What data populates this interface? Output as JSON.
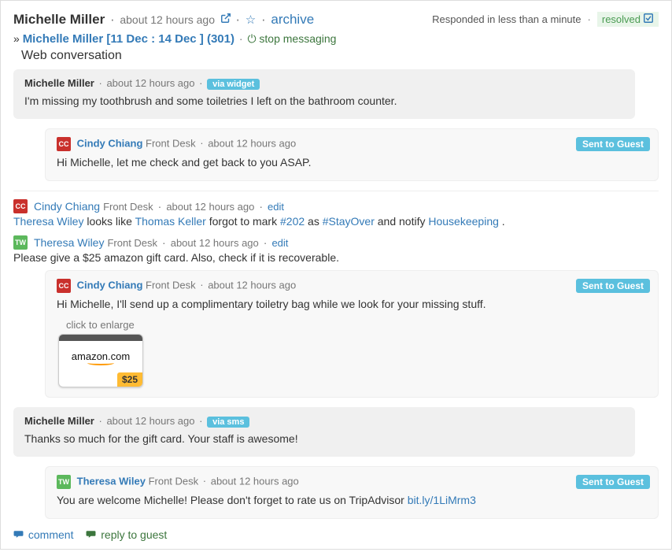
{
  "header": {
    "guest_name": "Michelle Miller",
    "timestamp": "about 12 hours ago",
    "archive_label": "archive",
    "responded_text": "Responded in less than a minute",
    "resolved_label": "resolved"
  },
  "subheader": {
    "booking_link": "Michelle Miller [11 Dec : 14 Dec ] (301)",
    "stop_label": "stop messaging"
  },
  "web_conversation_label": "Web conversation",
  "messages": [
    {
      "name": "Michelle Miller",
      "ts": "about 12 hours ago",
      "via": "via widget",
      "body": "I'm missing my toothbrush and some toiletries I left on the bathroom counter."
    },
    {
      "name": "Cindy Chiang",
      "role": "Front Desk",
      "ts": "about 12 hours ago",
      "sent_label": "Sent to Guest",
      "body": "Hi Michelle, let me check and get back to you ASAP."
    }
  ],
  "internal_notes": [
    {
      "avatar": "CC",
      "name": "Cindy Chiang",
      "role": "Front Desk",
      "ts": "about 12 hours ago",
      "edit": "edit",
      "body_pre": "",
      "mention1": "Theresa Wiley",
      "body_mid1": "  looks like ",
      "mention2": "Thomas Keller",
      "body_mid2": "  forgot to mark ",
      "room": "#202",
      "body_mid3": "  as ",
      "hashtag": "#StayOver",
      "body_mid4": "  and notify ",
      "mention3": "Housekeeping",
      "body_end": " ."
    },
    {
      "avatar": "TW",
      "name": "Theresa Wiley",
      "role": "Front Desk",
      "ts": "about 12 hours ago",
      "edit": "edit",
      "body": "Please give a $25 amazon gift card. Also, check if it is recoverable."
    }
  ],
  "messages2": [
    {
      "name": "Cindy Chiang",
      "role": "Front Desk",
      "ts": "about 12 hours ago",
      "sent_label": "Sent to Guest",
      "body": "Hi Michelle, I'll send up a complimentary toiletry bag while we look for your missing stuff.",
      "enlarge": "click to enlarge",
      "giftcard_logo": "amazon.com",
      "giftcard_price": "$25"
    },
    {
      "name": "Michelle Miller",
      "ts": "about 12 hours ago",
      "via": "via sms",
      "body": "Thanks so much for the gift card. Your staff is awesome!"
    },
    {
      "name": "Theresa Wiley",
      "role": "Front Desk",
      "ts": "about 12 hours ago",
      "sent_label": "Sent to Guest",
      "body_pre": "You are welcome Michelle! Please don't forget to rate us on TripAdvisor ",
      "link": "bit.ly/1LiMrm3"
    }
  ],
  "footer": {
    "comment": "comment",
    "reply": "reply to guest"
  },
  "avatars": {
    "cc": "CC",
    "tw": "TW"
  }
}
